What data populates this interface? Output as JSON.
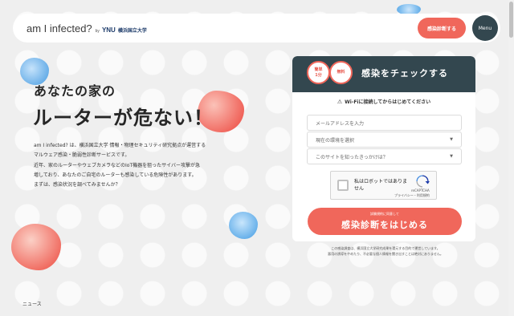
{
  "header": {
    "logo_text": "am I infected?",
    "logo_by": "by",
    "logo_ynu": "YNU",
    "logo_university": "横浜国立大学",
    "cta_label": "感染診断する",
    "menu_label": "Menu"
  },
  "hero": {
    "line1": "あなたの家の",
    "line2": "ルーターが危ない！",
    "intro": [
      "am I infected? は、横浜国立大学 情報・物理セキュリティ研究拠点が運営する",
      "マルウェア感染・脆弱性診断サービスです。",
      "近年、家のルーターやウェブカメラなどのIoT機器を狙ったサイバー攻撃が急",
      "増しており、あなたのご自宅のルーターも感染している危険性があります。",
      "まずは、感染状況を調べてみませんか？"
    ]
  },
  "form": {
    "badge_time_line1": "簡単",
    "badge_time_line2": "1分",
    "badge_free": "無料",
    "title": "感染をチェックする",
    "wifi_note": "Wi-Fiに接続してからはじめてください",
    "email_placeholder": "メールアドレスを入力",
    "environment_select": "現在の環境を選択",
    "source_select": "このサイトを知ったきっかけは？",
    "recaptcha_label": "私はロボットではありません",
    "recaptcha_brand": "reCAPTCHA",
    "recaptcha_links": "プライバシー・利用規約",
    "submit_sub": "試験規約に同意して",
    "submit_main": "感染診断をはじめる"
  },
  "disclaimer": [
    "この感染調査は、横浜国立大学研究成果を還元する目的で運営しています。",
    "悪用の誘導をやめたり、不必要な個人情報を聞き出すことは絶対にありません。"
  ],
  "footer": {
    "news_label": "ニュース"
  },
  "colors": {
    "accent": "#f0675b",
    "dark": "#33474f",
    "background": "#efefef"
  }
}
